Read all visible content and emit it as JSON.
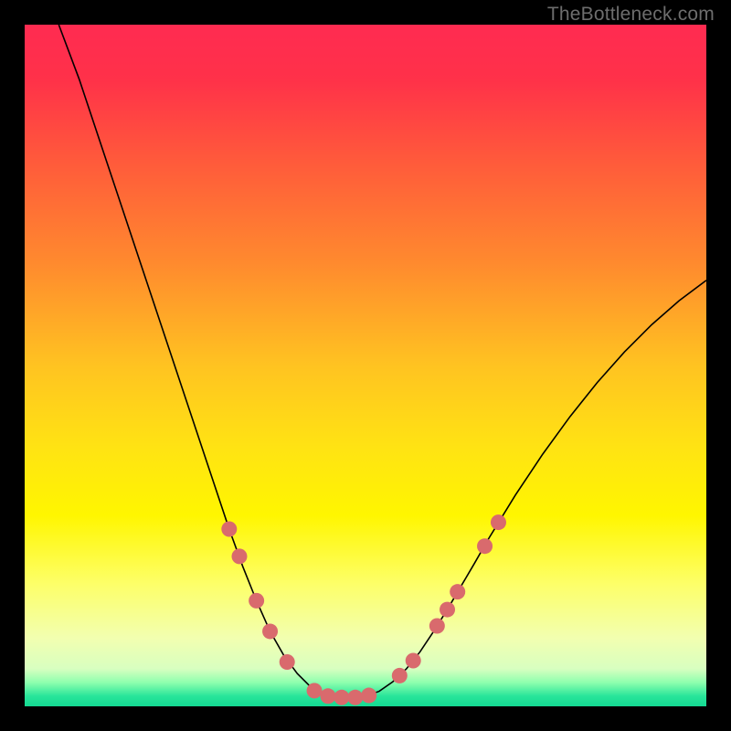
{
  "watermark": "TheBottleneck.com",
  "gradient_stops": [
    {
      "offset": 0.0,
      "color": "#ff2b51"
    },
    {
      "offset": 0.08,
      "color": "#ff3149"
    },
    {
      "offset": 0.2,
      "color": "#ff5a3b"
    },
    {
      "offset": 0.35,
      "color": "#ff8a2e"
    },
    {
      "offset": 0.5,
      "color": "#ffc321"
    },
    {
      "offset": 0.62,
      "color": "#ffe313"
    },
    {
      "offset": 0.72,
      "color": "#fff600"
    },
    {
      "offset": 0.82,
      "color": "#fdff68"
    },
    {
      "offset": 0.9,
      "color": "#f2ffb0"
    },
    {
      "offset": 0.945,
      "color": "#d8ffc0"
    },
    {
      "offset": 0.965,
      "color": "#8effae"
    },
    {
      "offset": 0.985,
      "color": "#28e59a"
    },
    {
      "offset": 1.0,
      "color": "#14d892"
    }
  ],
  "chart_data": {
    "type": "line",
    "title": "",
    "xlabel": "",
    "ylabel": "",
    "xlim": [
      0,
      100
    ],
    "ylim": [
      0,
      100
    ],
    "curve": [
      {
        "x": 5.0,
        "y": 100.0
      },
      {
        "x": 8.0,
        "y": 92.0
      },
      {
        "x": 12.0,
        "y": 80.0
      },
      {
        "x": 16.0,
        "y": 68.0
      },
      {
        "x": 20.0,
        "y": 56.0
      },
      {
        "x": 24.0,
        "y": 44.0
      },
      {
        "x": 28.0,
        "y": 32.0
      },
      {
        "x": 30.0,
        "y": 26.0
      },
      {
        "x": 32.0,
        "y": 20.5
      },
      {
        "x": 34.0,
        "y": 15.5
      },
      {
        "x": 36.0,
        "y": 11.0
      },
      {
        "x": 38.0,
        "y": 7.5
      },
      {
        "x": 40.0,
        "y": 4.8
      },
      {
        "x": 42.0,
        "y": 2.8
      },
      {
        "x": 44.0,
        "y": 1.6
      },
      {
        "x": 46.0,
        "y": 1.3
      },
      {
        "x": 48.0,
        "y": 1.3
      },
      {
        "x": 50.0,
        "y": 1.5
      },
      {
        "x": 52.0,
        "y": 2.2
      },
      {
        "x": 54.0,
        "y": 3.6
      },
      {
        "x": 56.0,
        "y": 5.5
      },
      {
        "x": 58.0,
        "y": 8.0
      },
      {
        "x": 60.0,
        "y": 11.0
      },
      {
        "x": 62.0,
        "y": 14.2
      },
      {
        "x": 64.0,
        "y": 17.6
      },
      {
        "x": 66.0,
        "y": 21.0
      },
      {
        "x": 68.0,
        "y": 24.5
      },
      {
        "x": 72.0,
        "y": 31.0
      },
      {
        "x": 76.0,
        "y": 37.0
      },
      {
        "x": 80.0,
        "y": 42.5
      },
      {
        "x": 84.0,
        "y": 47.5
      },
      {
        "x": 88.0,
        "y": 52.0
      },
      {
        "x": 92.0,
        "y": 56.0
      },
      {
        "x": 96.0,
        "y": 59.5
      },
      {
        "x": 100.0,
        "y": 62.5
      }
    ],
    "dots": [
      {
        "x": 30.0,
        "y": 26.0
      },
      {
        "x": 31.5,
        "y": 22.0
      },
      {
        "x": 34.0,
        "y": 15.5
      },
      {
        "x": 36.0,
        "y": 11.0
      },
      {
        "x": 38.5,
        "y": 6.5
      },
      {
        "x": 42.5,
        "y": 2.3
      },
      {
        "x": 44.5,
        "y": 1.5
      },
      {
        "x": 46.5,
        "y": 1.3
      },
      {
        "x": 48.5,
        "y": 1.3
      },
      {
        "x": 50.5,
        "y": 1.6
      },
      {
        "x": 55.0,
        "y": 4.5
      },
      {
        "x": 57.0,
        "y": 6.7
      },
      {
        "x": 60.5,
        "y": 11.8
      },
      {
        "x": 62.0,
        "y": 14.2
      },
      {
        "x": 63.5,
        "y": 16.8
      },
      {
        "x": 67.5,
        "y": 23.5
      },
      {
        "x": 69.5,
        "y": 27.0
      }
    ],
    "dot_radius_px": 8.5
  }
}
